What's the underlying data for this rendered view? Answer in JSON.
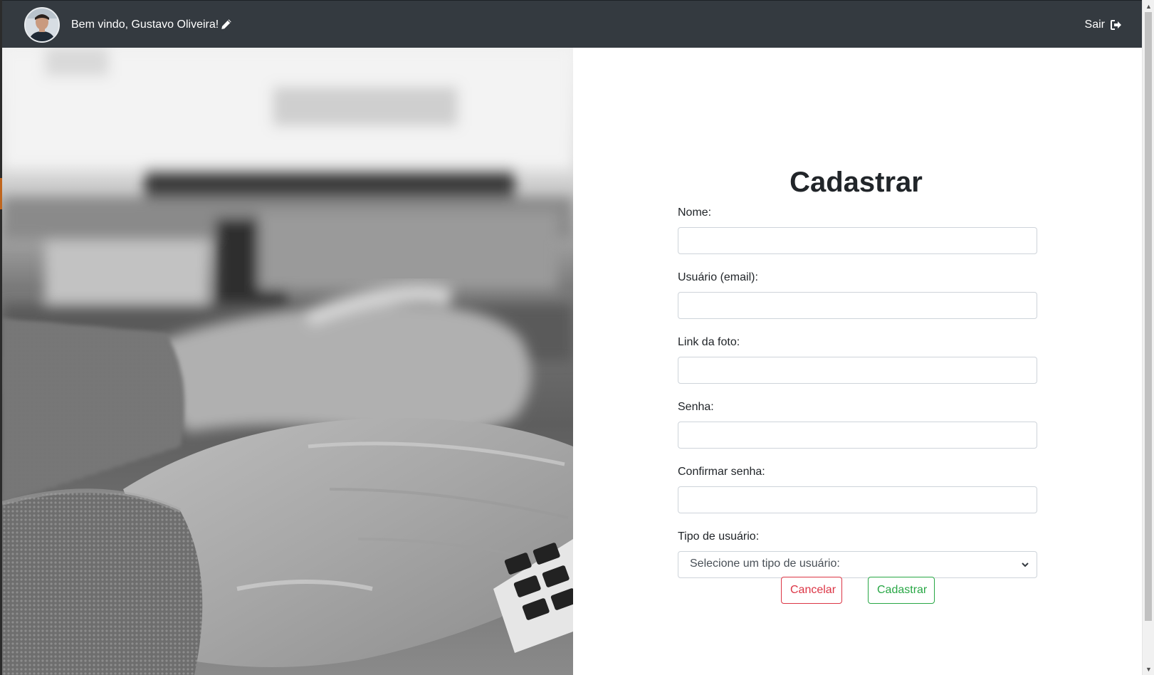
{
  "navbar": {
    "welcome_text": "Bem vindo, Gustavo Oliveira!",
    "avatar_alt": "Foto de Gustavo Oliveira",
    "logout_label": "Sair",
    "background": "#343a40"
  },
  "hero": {
    "image": "grayscale-hands-typing-on-keyboard"
  },
  "form": {
    "title": "Cadastrar",
    "fields": [
      {
        "label": "Nome:",
        "value": "",
        "placeholder": ""
      },
      {
        "label": "Usuário (email):",
        "value": "",
        "placeholder": ""
      },
      {
        "label": "Link da foto:",
        "value": "",
        "placeholder": ""
      },
      {
        "label": "Senha:",
        "value": "",
        "placeholder": ""
      },
      {
        "label": "Confirmar senha:",
        "value": "",
        "placeholder": ""
      }
    ],
    "user_type": {
      "label": "Tipo de usuário:",
      "selected": "Selecione um tipo de usuário:"
    },
    "cancel_label": "Cancelar",
    "submit_label": "Cadastrar",
    "colors": {
      "cancel": "#dc3545",
      "submit": "#28a745"
    }
  },
  "icons": {
    "edit": "pencil-icon",
    "logout": "sign-out-icon",
    "select": "chevron-down-icon"
  }
}
